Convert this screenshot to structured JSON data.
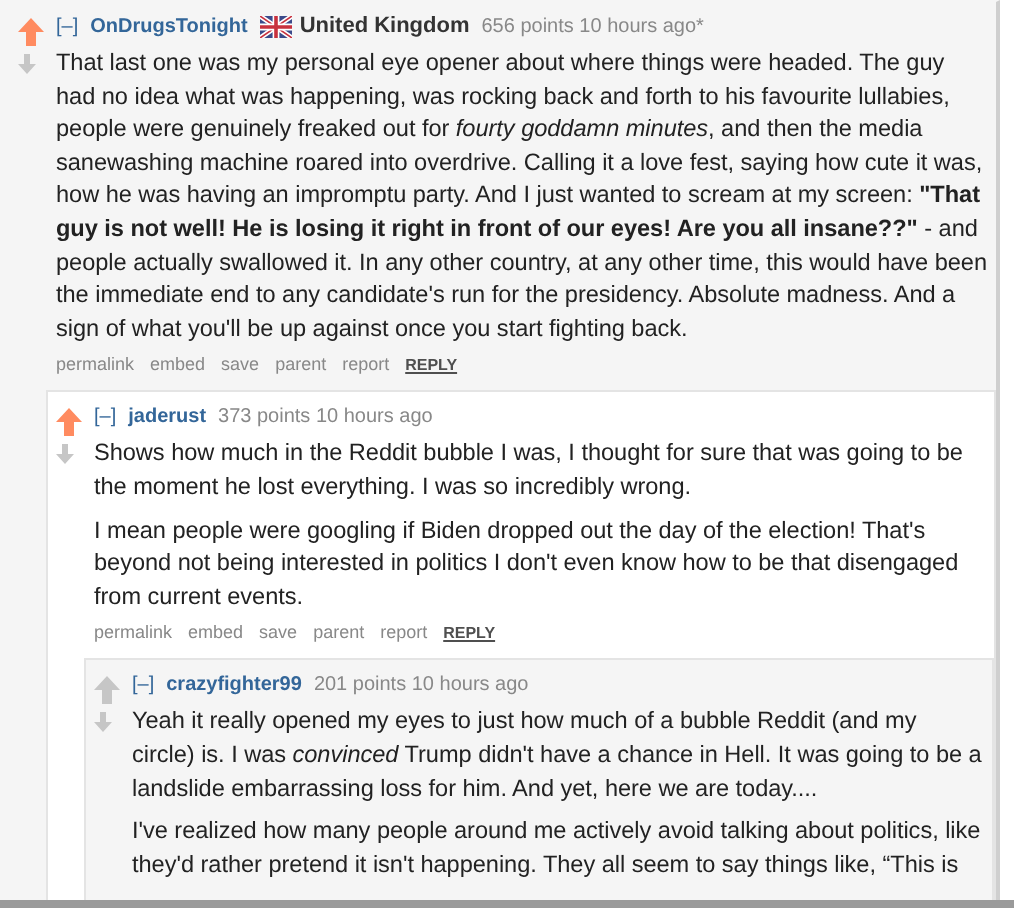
{
  "comments": [
    {
      "collapse": "[–]",
      "author": "OnDrugsTonight",
      "flair": {
        "text": "United Kingdom"
      },
      "score_time": "656 points 10 hours ago*",
      "upvoted": true,
      "paragraphs": [
        "That last one was my personal eye opener about where things were headed. The guy had no idea what was happening, was rocking back and forth to his favourite lullabies, people were genuinely freaked out for *fourty goddamn minutes*, and then the media sanewashing machine roared into overdrive. Calling it a love fest, saying how cute it was, how he was having an impromptu party. And I just wanted to scream at my screen: **\"That guy is not well! He is losing it right in front of our eyes! Are you all insane??\"** - and people actually swallowed it. In any other country, at any other time, this would have been the immediate end to any candidate's run for the presidency. Absolute madness. And a sign of what you'll be up against once you start fighting back."
      ],
      "actions": [
        "permalink",
        "embed",
        "save",
        "parent",
        "report"
      ],
      "reply": "REPLY",
      "children": [
        {
          "collapse": "[–]",
          "author": "jaderust",
          "score_time": "373 points 10 hours ago",
          "upvoted": true,
          "paragraphs": [
            "Shows how much in the Reddit bubble I was, I thought for sure that was going to be the moment he lost everything. I was so incredibly wrong.",
            "I mean people were googling if Biden dropped out the day of the election! That's beyond not being interested in politics I don't even know how to be that disengaged from current events."
          ],
          "actions": [
            "permalink",
            "embed",
            "save",
            "parent",
            "report"
          ],
          "reply": "REPLY",
          "children": [
            {
              "collapse": "[–]",
              "author": "crazyfighter99",
              "score_time": "201 points 10 hours ago",
              "upvoted": false,
              "paragraphs": [
                "Yeah it really opened my eyes to just how much of a bubble Reddit (and my circle) is. I was *convinced* Trump didn't have a chance in Hell. It was going to be a landslide embarrassing loss for him. And yet, here we are today....",
                "I've realized how many people around me actively avoid talking about politics, like they'd rather pretend it isn't happening. They all seem to say things like, “This is"
              ]
            }
          ]
        }
      ]
    }
  ]
}
